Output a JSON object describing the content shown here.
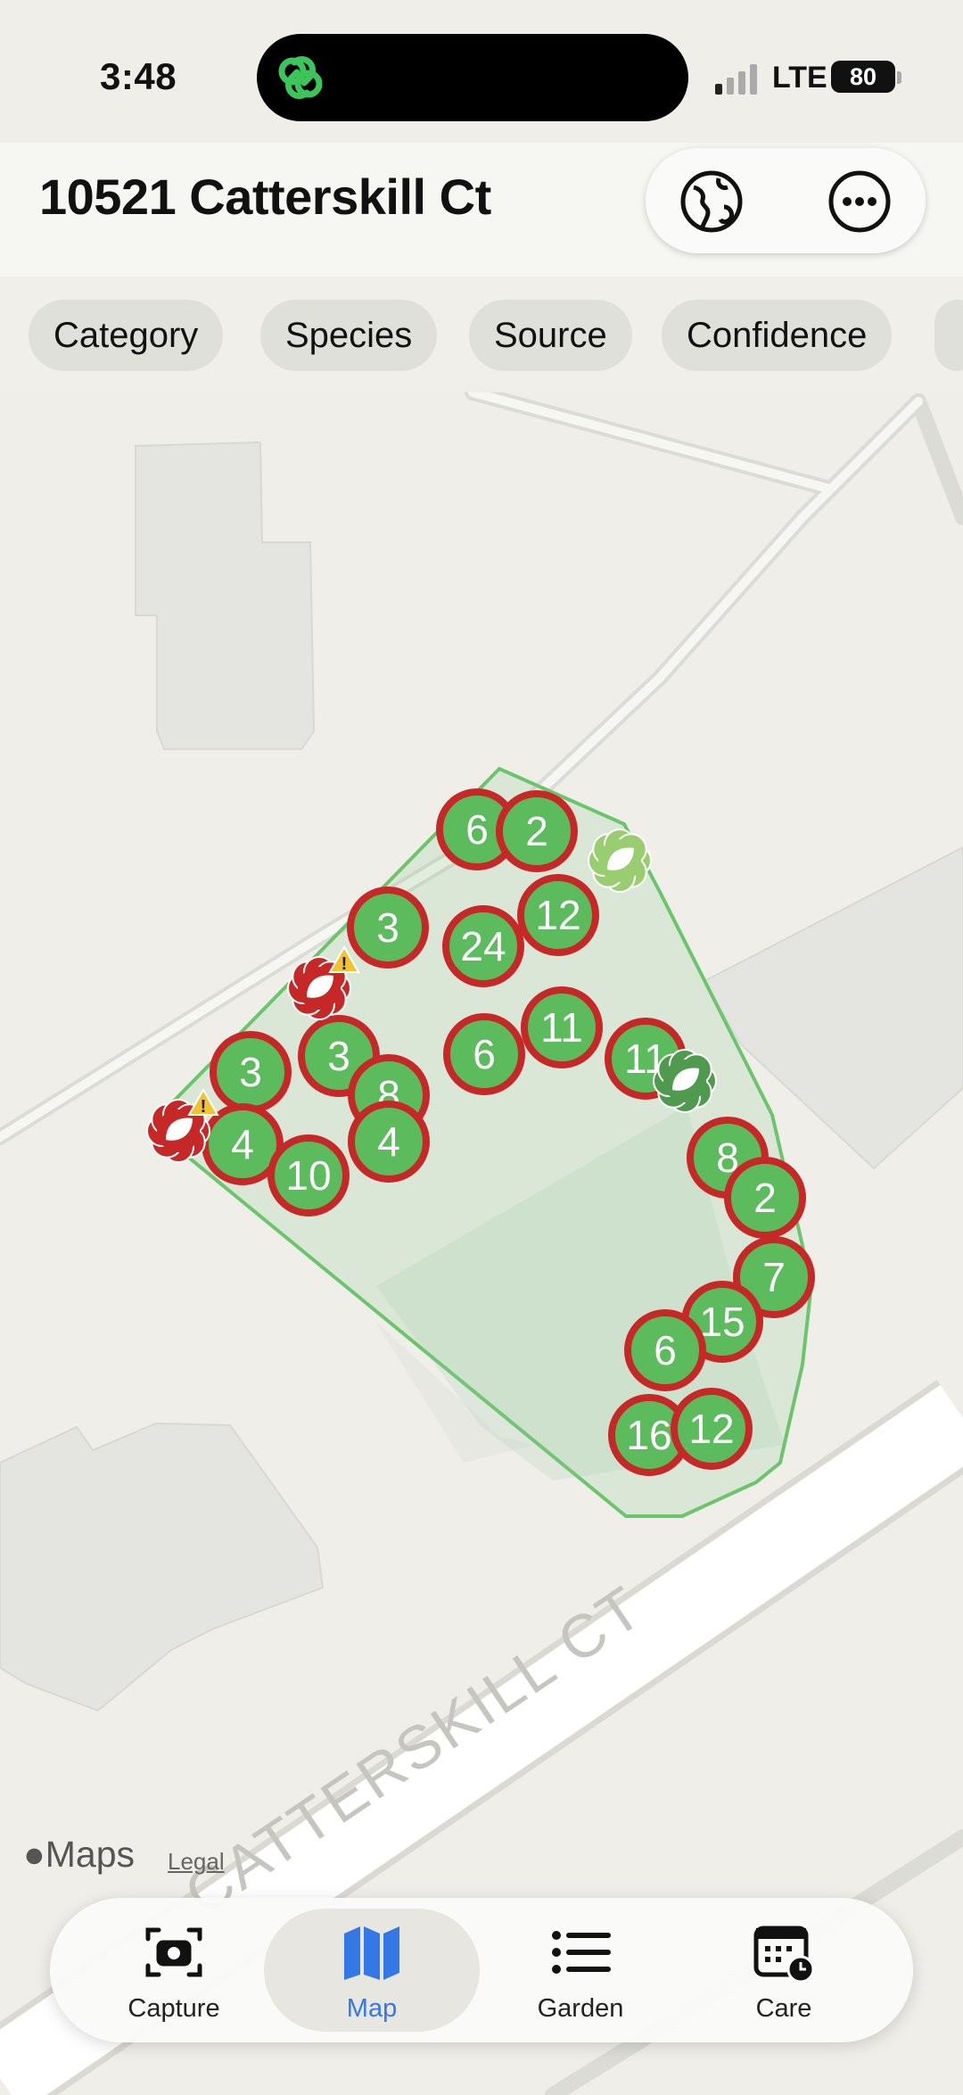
{
  "status_bar": {
    "time": "3:48",
    "network": "LTE",
    "battery": "80"
  },
  "header": {
    "title": "10521 Catterskill Ct",
    "globe_icon": "globe-icon",
    "more_icon": "ellipsis-circle-icon"
  },
  "filters": [
    "Category",
    "Species",
    "Source",
    "Confidence"
  ],
  "map": {
    "street_label": "CATTERSKILL CT",
    "attribution": "Maps",
    "legal": "Legal",
    "clusters": [
      "6",
      "2",
      "12",
      "3",
      "24",
      "3",
      "3",
      "8",
      "6",
      "11",
      "11",
      "4",
      "4",
      "10",
      "8",
      "2",
      "7",
      "15",
      "6",
      "16",
      "12"
    ],
    "marker_colors": {
      "cluster_fill": "#5cbb5c",
      "cluster_ring": "#c62828",
      "boundary": "#6cc56c",
      "warning": "#f2c230"
    }
  },
  "tabs": [
    {
      "label": "Capture",
      "icon": "camera-icon"
    },
    {
      "label": "Map",
      "icon": "map-icon",
      "active": true
    },
    {
      "label": "Garden",
      "icon": "list-icon"
    },
    {
      "label": "Care",
      "icon": "calendar-clock-icon"
    }
  ],
  "colors": {
    "accent": "#3478e6"
  }
}
